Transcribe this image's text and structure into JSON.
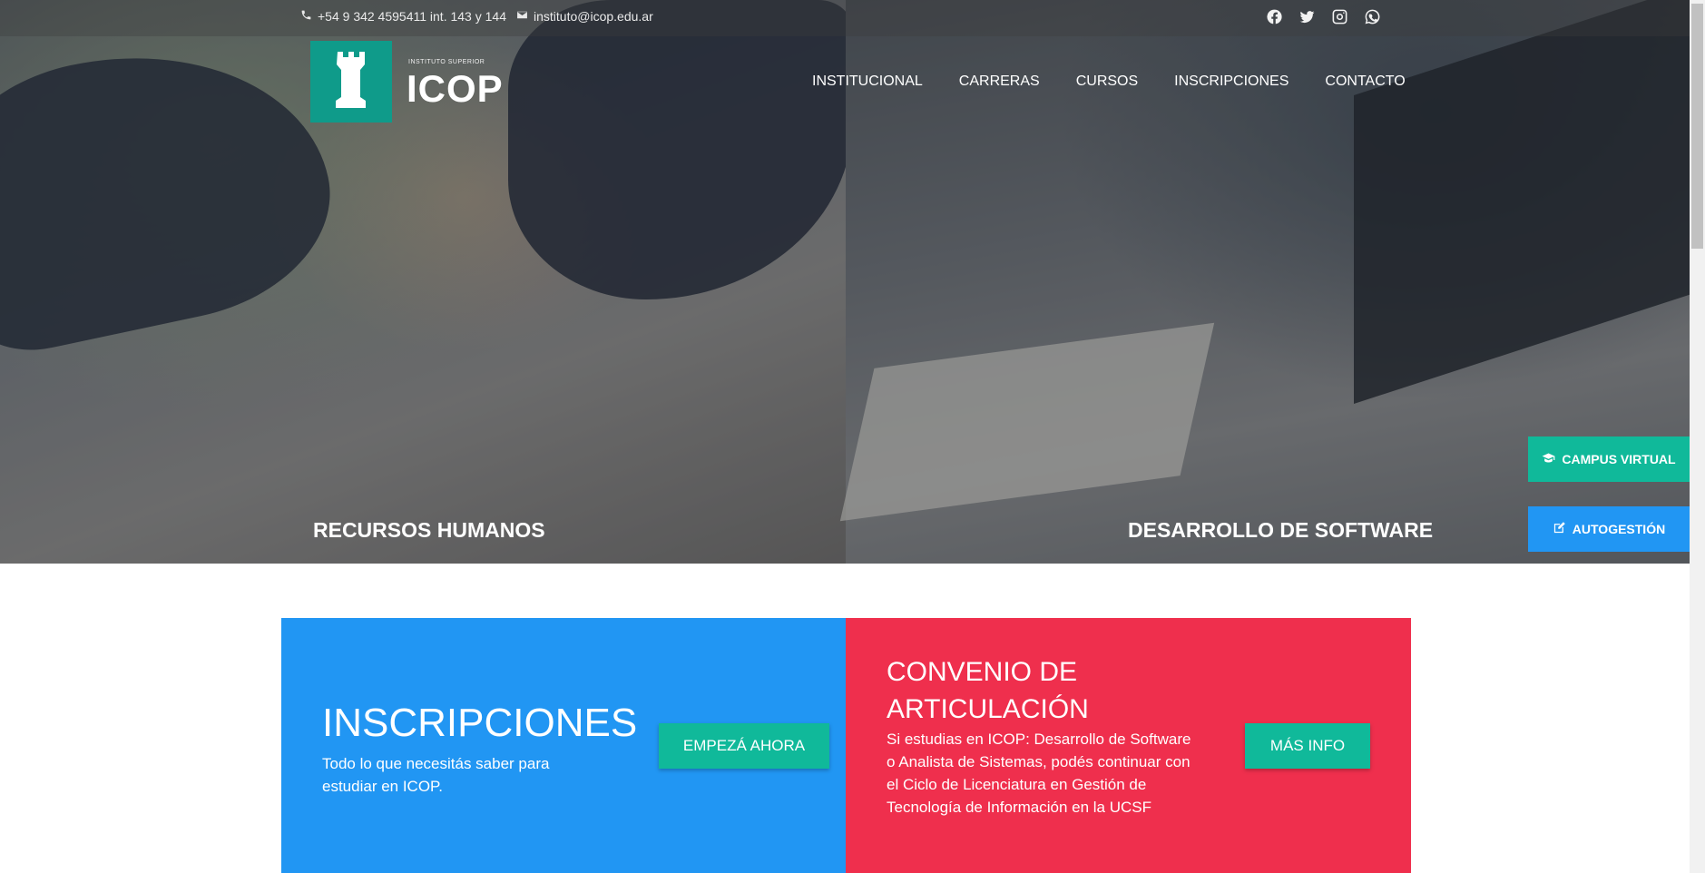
{
  "topbar": {
    "phone": "+54 9 342 4595411 int. 143 y 144",
    "email": "instituto@icop.edu.ar",
    "social_icons": [
      "facebook-icon",
      "twitter-icon",
      "instagram-icon",
      "whatsapp-icon"
    ]
  },
  "logo": {
    "sub": "INSTITUTO SUPERIOR",
    "name": "ICOP"
  },
  "nav": [
    "INSTITUCIONAL",
    "CARRERAS",
    "CURSOS",
    "INSCRIPCIONES",
    "CONTACTO"
  ],
  "hero": {
    "left_title": "RECURSOS HUMANOS",
    "right_title": "DESARROLLO DE SOFTWARE"
  },
  "side_buttons": {
    "campus": "CAMPUS VIRTUAL",
    "autogestion": "AUTOGESTIÓN"
  },
  "cards": {
    "inscripciones": {
      "title": "INSCRIPCIONES",
      "text": "Todo lo que necesitás saber para estudiar en ICOP.",
      "button": "EMPEZÁ AHORA"
    },
    "convenio": {
      "title_line1": "CONVENIO DE",
      "title_line2": "ARTICULACIÓN",
      "text": "Si estudias en ICOP: Desarrollo de Software o Analista de Sistemas, podés continuar con el Ciclo de Licenciatura en Gestión de Tecnología de Información en la UCSF",
      "button": "MÁS INFO"
    }
  },
  "colors": {
    "teal": "#0f9b8a",
    "blue": "#2196f3",
    "red": "#ef2f4d",
    "button_green": "#10b99a"
  }
}
